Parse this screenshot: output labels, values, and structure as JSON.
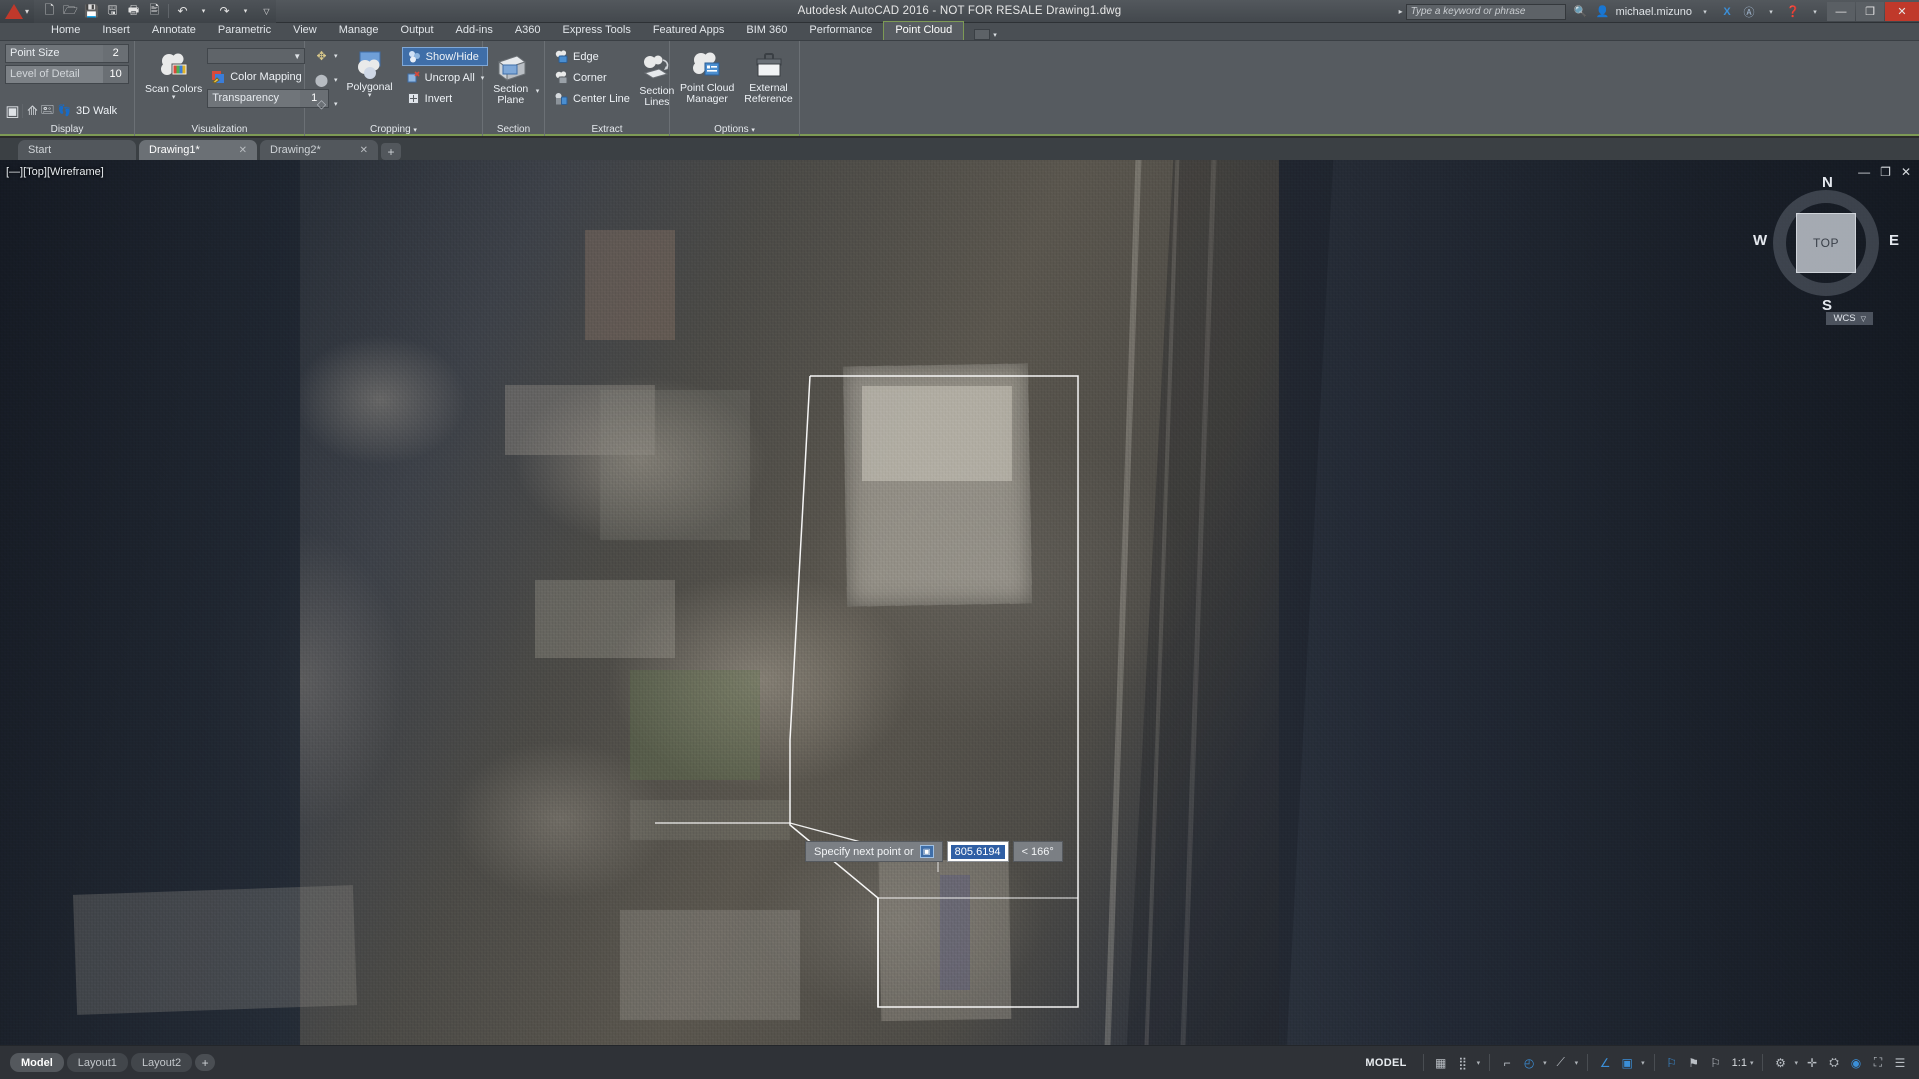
{
  "titlebar": {
    "title": "Autodesk AutoCAD 2016 - NOT FOR RESALE     Drawing1.dwg",
    "app_menu": "A",
    "quick_access": [
      {
        "name": "new-icon",
        "glyph": "🗋"
      },
      {
        "name": "open-icon",
        "glyph": "🗁"
      },
      {
        "name": "save-icon",
        "glyph": "🖫"
      },
      {
        "name": "save-as-icon",
        "glyph": "🖬"
      },
      {
        "name": "plot-icon",
        "glyph": "🖶"
      },
      {
        "name": "plot-preview-icon",
        "glyph": "🖻"
      },
      {
        "name": "undo-icon",
        "glyph": "↶"
      },
      {
        "name": "undo-dropdown-icon",
        "glyph": "▾"
      },
      {
        "name": "redo-icon",
        "glyph": "↷"
      },
      {
        "name": "redo-dropdown-icon",
        "glyph": "▾"
      },
      {
        "name": "qat-customize-icon",
        "glyph": "▿"
      }
    ],
    "search_placeholder": "Type a keyword or phrase",
    "search_arrow": "▸",
    "infocenter_icon": "🔍",
    "user_name": "michael.mizuno",
    "user_caret": "▾",
    "exchange_icon": "X",
    "autodesk_icon": "A",
    "autodesk_caret": "▾",
    "help_icon": "?",
    "help_caret": "▾",
    "win_minimize": "—",
    "win_restore": "❐",
    "win_close": "✕"
  },
  "ribbon_tabs": [
    {
      "label": "Home",
      "active": false
    },
    {
      "label": "Insert",
      "active": false
    },
    {
      "label": "Annotate",
      "active": false
    },
    {
      "label": "Parametric",
      "active": false
    },
    {
      "label": "View",
      "active": false
    },
    {
      "label": "Manage",
      "active": false
    },
    {
      "label": "Output",
      "active": false
    },
    {
      "label": "Add-ins",
      "active": false
    },
    {
      "label": "A360",
      "active": false
    },
    {
      "label": "Express Tools",
      "active": false
    },
    {
      "label": "Featured Apps",
      "active": false
    },
    {
      "label": "BIM 360",
      "active": false
    },
    {
      "label": "Performance",
      "active": false
    },
    {
      "label": "Point Cloud",
      "active": true
    }
  ],
  "ribbon": {
    "panels": [
      {
        "name": "display",
        "label": "Display",
        "point_size": {
          "label": "Point Size",
          "value": "2"
        },
        "level_of_detail": {
          "label": "Level of Detail",
          "value": "10"
        },
        "buttons": [
          {
            "name": "point-cloud-box-icon",
            "glyph": "▣"
          },
          {
            "name": "dynamic-ucs-icon",
            "glyph": "⟰"
          },
          {
            "name": "point-cloud-camera-icon",
            "glyph": "📷"
          },
          {
            "name": "3d-walk-icon",
            "glyph": "👣",
            "label": "3D Walk"
          }
        ]
      },
      {
        "name": "visualization",
        "label": "Visualization",
        "scan_colors": {
          "label": "Scan Colors",
          "caret": "▾"
        },
        "style_combo": {
          "value": "▾"
        },
        "color_mapping": {
          "label": "Color Mapping"
        },
        "transparency": {
          "label": "Transparency",
          "value": "1"
        }
      },
      {
        "name": "cropping",
        "label": "Cropping",
        "label_caret": "▾",
        "small_tools": [
          {
            "name": "crop-rectangular-icon",
            "glyph": "✥",
            "caret": "▾"
          },
          {
            "name": "crop-circular-icon",
            "glyph": "⬤",
            "caret": "▾"
          },
          {
            "name": "crop-polygonal-icon",
            "glyph": "◇",
            "caret": "▾"
          }
        ],
        "polygonal": {
          "label": "Polygonal",
          "caret": "▾"
        },
        "show_hide": {
          "label": "Show/Hide",
          "selected": true
        },
        "uncrop_all": {
          "label": "Uncrop All",
          "caret": "▾"
        },
        "invert": {
          "label": "Invert"
        }
      },
      {
        "name": "section",
        "label": "Section",
        "section_plane": {
          "label_line1": "Section",
          "label_line2": "Plane",
          "caret": "▾"
        }
      },
      {
        "name": "extract",
        "label": "Extract",
        "edge": {
          "label": "Edge"
        },
        "corner": {
          "label": "Corner"
        },
        "center_line": {
          "label": "Center Line"
        },
        "section_lines": {
          "label_line1": "Section",
          "label_line2": "Lines"
        }
      },
      {
        "name": "options",
        "label": "Options",
        "label_caret": "▾",
        "point_cloud_manager": {
          "label_line1": "Point Cloud",
          "label_line2": "Manager"
        },
        "external_reference": {
          "label_line1": "External",
          "label_line2": "Reference"
        }
      }
    ]
  },
  "file_tabs": [
    {
      "label": "Start",
      "active": false,
      "close": ""
    },
    {
      "label": "Drawing1*",
      "active": true,
      "close": "✕"
    },
    {
      "label": "Drawing2*",
      "active": false,
      "close": "✕"
    }
  ],
  "file_tab_add": "+",
  "viewport": {
    "label": "[—][Top][Wireframe]",
    "controls": [
      {
        "name": "viewport-minimize-icon",
        "glyph": "—"
      },
      {
        "name": "viewport-restore-icon",
        "glyph": "❐"
      },
      {
        "name": "viewport-close-icon",
        "glyph": "✕"
      }
    ],
    "viewcube": {
      "face": "TOP",
      "north": "N",
      "south": "S",
      "west": "W",
      "east": "E"
    },
    "wcs": {
      "label": "WCS",
      "caret": "▽"
    }
  },
  "dynamic_input": {
    "prompt": "Specify next point or",
    "kbd_glyph": "▣",
    "distance_value": "805.6194",
    "angle_value": "< 166°"
  },
  "status_bar": {
    "layout_tabs": [
      {
        "label": "Model",
        "active": true
      },
      {
        "label": "Layout1",
        "active": false
      },
      {
        "label": "Layout2",
        "active": false
      }
    ],
    "layout_add": "+",
    "model_label": "MODEL",
    "tools": [
      {
        "name": "grid-display-icon",
        "glyph": "▦",
        "active": false
      },
      {
        "name": "snap-mode-icon",
        "glyph": "⣿",
        "active": false
      },
      {
        "name": "snap-dropdown-icon",
        "glyph": "▾",
        "caret": true
      },
      {
        "name": "ortho-mode-icon",
        "glyph": "⌐",
        "active": false
      },
      {
        "name": "polar-tracking-icon",
        "glyph": "◴",
        "active": true
      },
      {
        "name": "polar-dropdown-icon",
        "glyph": "▾",
        "caret": true
      },
      {
        "name": "object-snap-icon",
        "glyph": "⟋",
        "active": false
      },
      {
        "name": "osnap-dropdown-icon",
        "glyph": "▾",
        "caret": true
      },
      {
        "name": "object-snap-tracking-icon",
        "glyph": "∠",
        "active": true
      },
      {
        "name": "ucs-icon",
        "glyph": "▣",
        "active": true
      },
      {
        "name": "ucs-dropdown-icon",
        "glyph": "▾",
        "caret": true
      },
      {
        "name": "annotation-visibility-icon",
        "glyph": "ᚷ",
        "active": true
      },
      {
        "name": "autoscale-icon",
        "glyph": "ᚵ",
        "active": false
      },
      {
        "name": "annotation-scale-icon",
        "glyph": "ᚴ",
        "active": false
      }
    ],
    "scale": "1:1",
    "scale_caret": "▾",
    "right_tools": [
      {
        "name": "workspace-switching-icon",
        "glyph": "✿",
        "active": false
      },
      {
        "name": "workspace-dropdown-icon",
        "glyph": "▾",
        "caret": true
      },
      {
        "name": "hardware-acceleration-icon",
        "glyph": "✛",
        "active": false
      },
      {
        "name": "isolate-objects-icon",
        "glyph": "⛭",
        "active": false
      },
      {
        "name": "clean-screen-status-icon",
        "glyph": "◉",
        "active": true
      },
      {
        "name": "fullscreen-icon",
        "glyph": "⛶",
        "active": false
      },
      {
        "name": "customization-icon",
        "glyph": "☰",
        "active": false
      }
    ]
  },
  "colors": {
    "accent_green": "#7d9a55",
    "selection_blue": "#3f6ea8",
    "canvas_bg": "#1d2128",
    "ribbon_bg": "#565b60"
  }
}
